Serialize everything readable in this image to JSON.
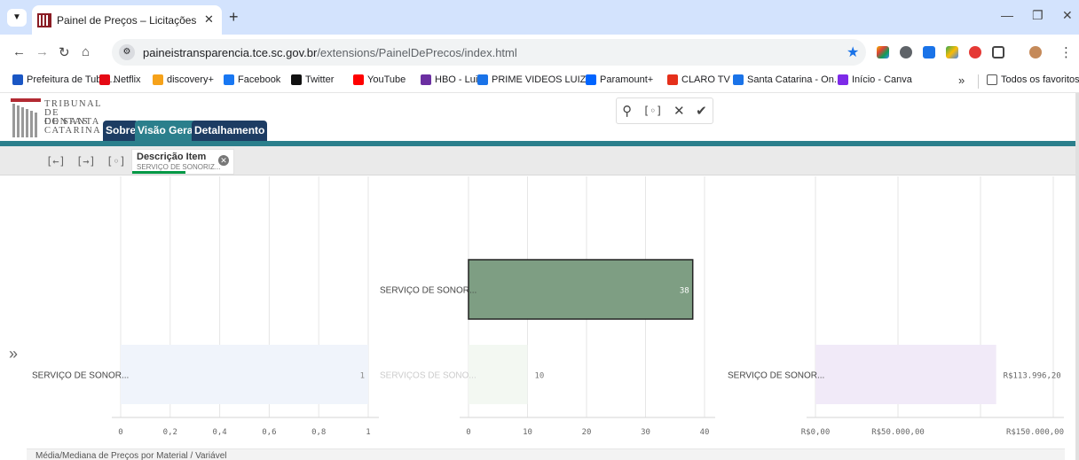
{
  "browser": {
    "tab_title": "Painel de Preços – Licitações",
    "url_host": "paineistransparencia.tce.sc.gov.br",
    "url_path": "/extensions/PainelDePrecos/index.html",
    "bookmarks": [
      {
        "label": "Prefeitura de Tubar...",
        "color": "#1a56c4"
      },
      {
        "label": "Netflix",
        "color": "#e50914"
      },
      {
        "label": "discovery+",
        "color": "#f6a21a"
      },
      {
        "label": "Facebook",
        "color": "#1877f2"
      },
      {
        "label": "Twitter",
        "color": "#111111"
      },
      {
        "label": "YouTube",
        "color": "#ff0000"
      },
      {
        "label": "HBO - Luiz",
        "color": "#6b2fa1"
      },
      {
        "label": "PRIME VIDEOS LUIZ",
        "color": "#1a73e8"
      },
      {
        "label": "Paramount+",
        "color": "#0064ff"
      },
      {
        "label": "CLARO TV",
        "color": "#e5301b"
      },
      {
        "label": "Santa Catarina - On...",
        "color": "#1a73e8"
      },
      {
        "label": "Início - Canva",
        "color": "#7d2ae8"
      }
    ],
    "bookmarks_all": "Todos os favoritos"
  },
  "app": {
    "logo_lines": [
      "TRIBUNAL",
      "DE CONTAS",
      "DE SANTA",
      "CATARINA"
    ],
    "nav_tabs": [
      {
        "label": "Sobre",
        "active": false
      },
      {
        "label": "Visão Geral",
        "active": true
      },
      {
        "label": "Detalhamento",
        "active": false
      }
    ],
    "selection": {
      "title": "Descrição Item",
      "value": "SERVIÇO DE SONORIZ..."
    },
    "bottom_text": "Média/Mediana de Preços por Material / Variável"
  },
  "colors": {
    "teal": "#2b7f8c",
    "navy": "#1d3c63",
    "selected_bar": "#7e9e83",
    "chart1_bar": "#f0f4fb",
    "chart2_bar_dim": "#f3f8f2",
    "chart3_bar": "#f1eaf8"
  },
  "chart_data": [
    {
      "type": "bar",
      "orientation": "horizontal",
      "categories": [
        "SERVIÇO DE SONOR..."
      ],
      "values": [
        1
      ],
      "data_labels": [
        "1"
      ],
      "xlim": [
        0,
        1
      ],
      "xticks": [
        "0",
        "0,2",
        "0,4",
        "0,6",
        "0,8",
        "1"
      ]
    },
    {
      "type": "bar",
      "orientation": "horizontal",
      "categories": [
        "SERVIÇO DE SONOR...",
        "SERVIÇOS DE SONO..."
      ],
      "values": [
        38,
        10
      ],
      "data_labels": [
        "38",
        "10"
      ],
      "selected": [
        true,
        false
      ],
      "xlim": [
        0,
        40
      ],
      "xticks": [
        "0",
        "10",
        "20",
        "30",
        "40"
      ]
    },
    {
      "type": "bar",
      "orientation": "horizontal",
      "categories": [
        "SERVIÇO DE SONOR..."
      ],
      "values": [
        113996.2
      ],
      "data_labels": [
        "R$113.996,20"
      ],
      "xlim": [
        0,
        150000
      ],
      "xticks": [
        "R$0,00",
        "R$50.000,00",
        "R$150.000,00"
      ]
    }
  ]
}
